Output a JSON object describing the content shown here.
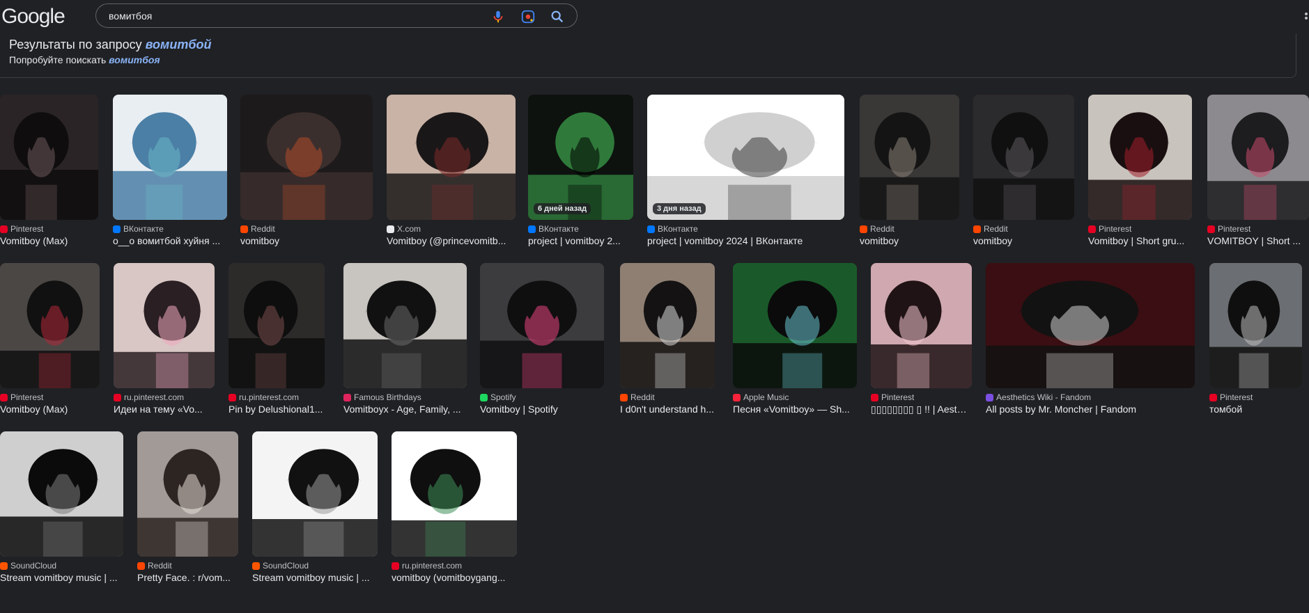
{
  "brand": {
    "logo_text": "Google"
  },
  "search": {
    "query": "вомитбоя"
  },
  "suggestion": {
    "results_prefix": "Результаты по запросу ",
    "results_term": "вомитбой",
    "try_prefix": "Попробуйте поискать ",
    "try_term": "вомитбоя"
  },
  "colors": {
    "pinterest": "#e60023",
    "vk": "#0077ff",
    "reddit": "#ff4500",
    "x": "#e8eaed",
    "soundcloud": "#ff5500",
    "spotify": "#1ed760",
    "famous": "#e0245e",
    "apple": "#fa233b",
    "fandom": "#7b4fe0",
    "link": "#8ab4f8"
  },
  "results": [
    {
      "source": "Pinterest",
      "title": "Vomitboy (Max)",
      "favicon": "pinterest",
      "badge": ""
    },
    {
      "source": "ВКонтакте",
      "title": "o__o вомитбой хуйня ...",
      "favicon": "vk",
      "badge": ""
    },
    {
      "source": "Reddit",
      "title": "vomitboy",
      "favicon": "reddit",
      "badge": ""
    },
    {
      "source": "X.com",
      "title": "Vomitboy (@princevomitb...",
      "favicon": "x",
      "badge": ""
    },
    {
      "source": "ВКонтакте",
      "title": "project | vomitboy 2...",
      "favicon": "vk",
      "badge": "6 дней назад"
    },
    {
      "source": "ВКонтакте",
      "title": "project | vomitboy 2024 | ВКонтакте",
      "favicon": "vk",
      "badge": "3 дня назад"
    },
    {
      "source": "Reddit",
      "title": "vomitboy",
      "favicon": "reddit",
      "badge": ""
    },
    {
      "source": "Reddit",
      "title": "vomitboy",
      "favicon": "reddit",
      "badge": ""
    },
    {
      "source": "Pinterest",
      "title": "Vomitboy | Short gru...",
      "favicon": "pinterest",
      "badge": ""
    },
    {
      "source": "Pinterest",
      "title": "VOMITBOY | Short ...",
      "favicon": "pinterest",
      "badge": ""
    },
    {
      "source": "Pinterest",
      "title": "Vomitboy (Max)",
      "favicon": "pinterest",
      "badge": ""
    },
    {
      "source": "ru.pinterest.com",
      "title": "Идеи на тему «Vo...",
      "favicon": "pinterest",
      "badge": ""
    },
    {
      "source": "ru.pinterest.com",
      "title": "Pin by Delushional1...",
      "favicon": "pinterest",
      "badge": ""
    },
    {
      "source": "Famous Birthdays",
      "title": "Vomitboyx - Age, Family, ...",
      "favicon": "famous",
      "badge": ""
    },
    {
      "source": "Spotify",
      "title": "Vomitboy | Spotify",
      "favicon": "spotify",
      "badge": ""
    },
    {
      "source": "Reddit",
      "title": "I d0n't understand h...",
      "favicon": "reddit",
      "badge": ""
    },
    {
      "source": "Apple Music",
      "title": "Песня «Vomitboy» — Sh...",
      "favicon": "apple",
      "badge": ""
    },
    {
      "source": "Pinterest",
      "title": "▯▯▯▯▯▯▯▯ ▯ !! | Aesthe...",
      "favicon": "pinterest",
      "badge": ""
    },
    {
      "source": "Aesthetics Wiki - Fandom",
      "title": "All posts by Mr. Moncher | Fandom",
      "favicon": "fandom",
      "badge": ""
    },
    {
      "source": "Pinterest",
      "title": "томбой",
      "favicon": "pinterest",
      "badge": ""
    },
    {
      "source": "SoundCloud",
      "title": "Stream vomitboy music | ...",
      "favicon": "soundcloud",
      "badge": ""
    },
    {
      "source": "Reddit",
      "title": "Pretty Face. : r/vom...",
      "favicon": "reddit",
      "badge": ""
    },
    {
      "source": "SoundCloud",
      "title": "Stream vomitboy music | ...",
      "favicon": "soundcloud",
      "badge": ""
    },
    {
      "source": "ru.pinterest.com",
      "title": "vomitboy (vomitboygang...",
      "favicon": "pinterest",
      "badge": ""
    }
  ]
}
